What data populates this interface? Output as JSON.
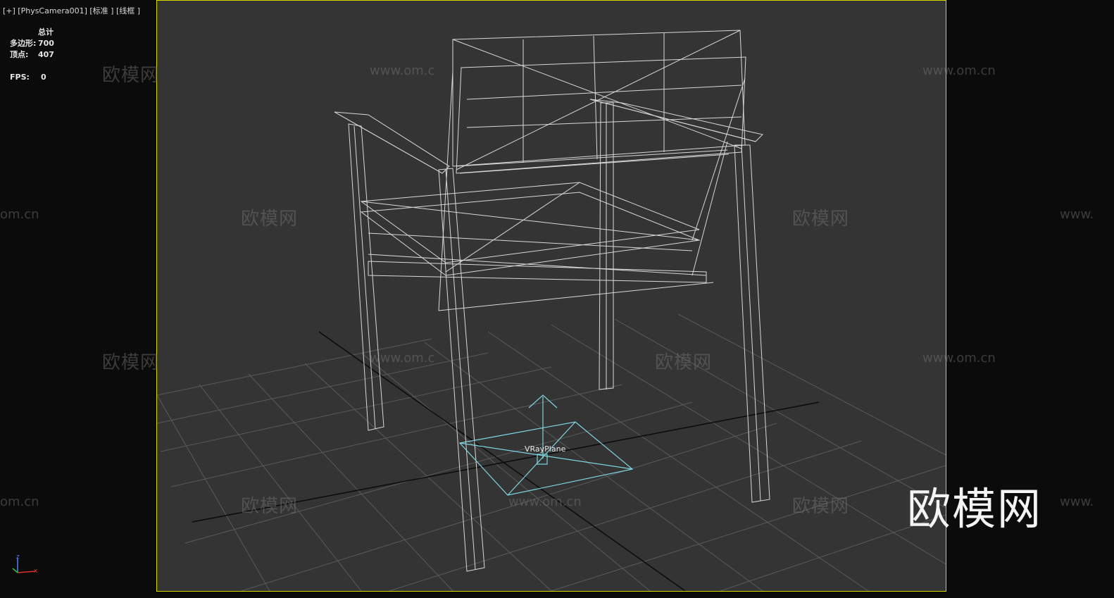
{
  "viewport": {
    "label": "[+] [PhysCamera001] [标准 ] [线框 ]",
    "border_color": "#d7d700",
    "background": "#343434"
  },
  "stats": {
    "header": "总计",
    "polygons_label": "多边形:",
    "polygons": "700",
    "vertices_label": "顶点:",
    "vertices": "407",
    "fps_label": "FPS:",
    "fps": "0"
  },
  "scene": {
    "object_label": "VRayPlane",
    "gizmo_color": "#7fd6e0",
    "wire_color": "#e6e6e6"
  },
  "watermarks": {
    "brand": "欧模网",
    "url": "www.om.cn",
    "url_partial": "om.cn",
    "url_left_partial": "www.om.c",
    "url_right_partial": "www."
  },
  "axis_tripod": {
    "z": "z",
    "x": "x"
  }
}
